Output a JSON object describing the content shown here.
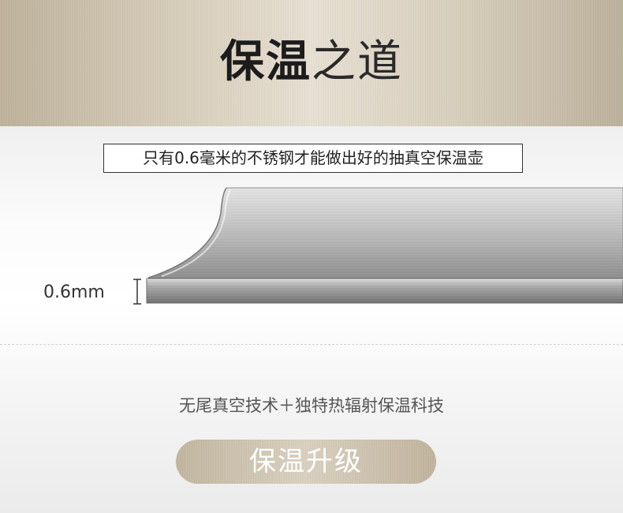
{
  "header": {
    "title_bold": "保温",
    "title_light": "之道"
  },
  "subtitle": "只有0.6毫米的不锈钢才能做出好的抽真空保温壶",
  "steel": {
    "thickness_label": "0.6mm"
  },
  "tech_text": "无尾真空技术＋独特热辐射保温科技",
  "badge_label": "保温升级",
  "colors": {
    "gold": "#cfc4ad",
    "dark_text": "#1c1c1c"
  }
}
